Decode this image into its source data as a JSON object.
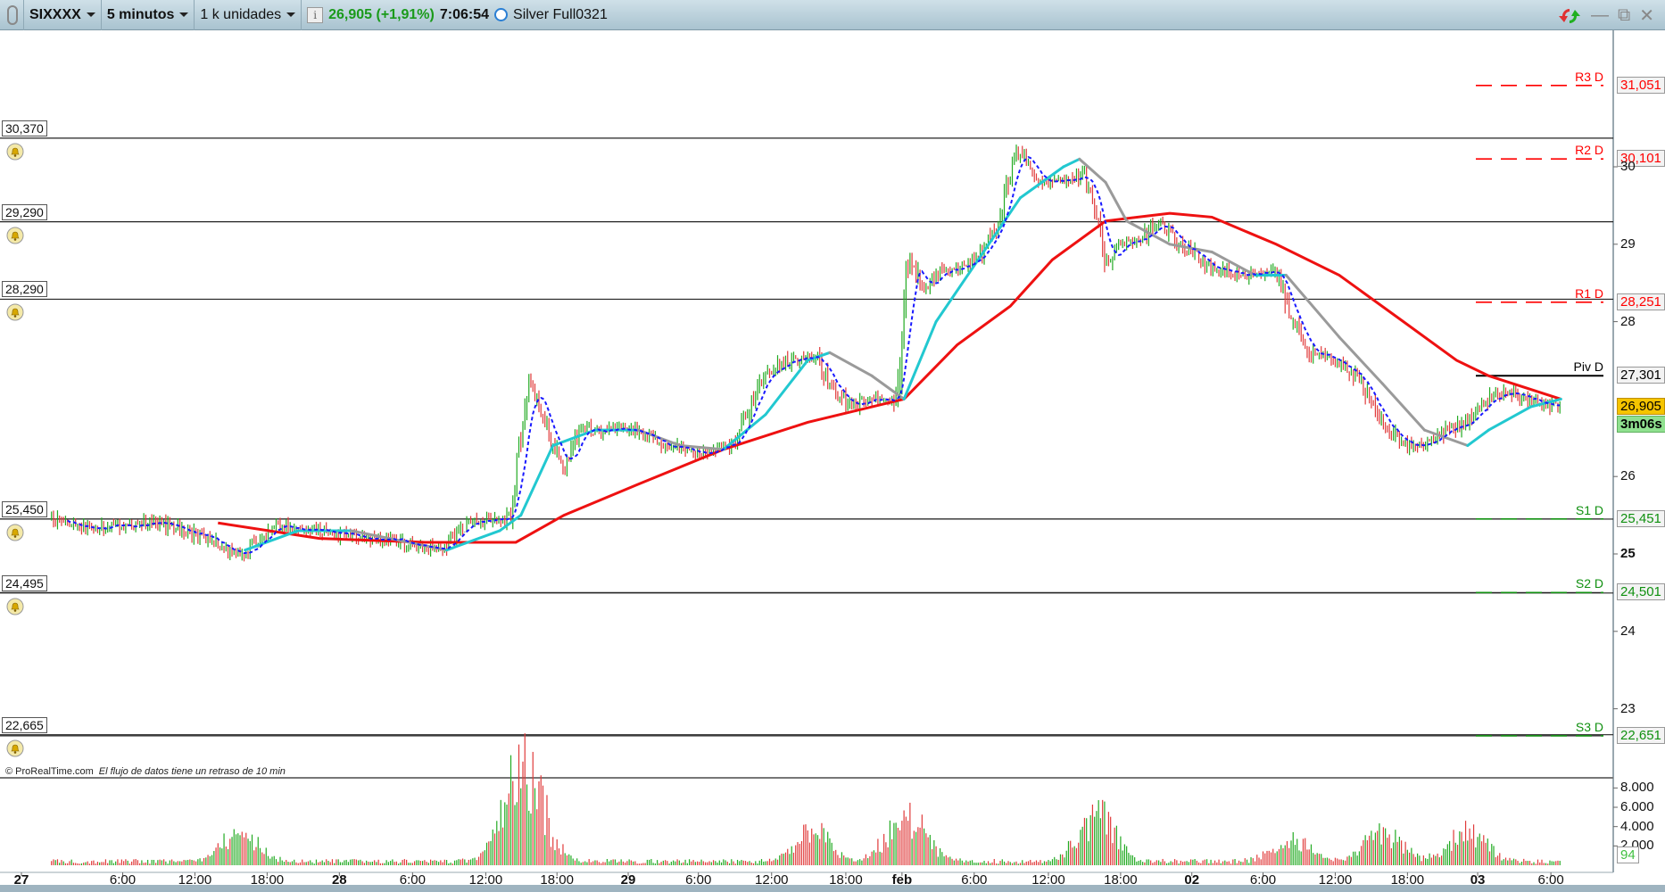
{
  "toolbar": {
    "symbol": "SIXXXX",
    "timeframe": "5 minutos",
    "units": "1 k unidades",
    "price": "26,905 (+1,91%)",
    "time": "7:06:54",
    "instrument": "Silver Full0321"
  },
  "footer": {
    "copyright": "© ProRealTime.com",
    "delay_notice": "El flujo de datos tiene un retraso de 10 min"
  },
  "colors": {
    "up": "#22aa22",
    "down": "#e03a3a",
    "long_ma": "#ee1111",
    "trend_up": "#22c8d0",
    "trend_down": "#9a9a9a",
    "fast_ma": "#1a1aff",
    "resistance": "#ff0000",
    "support": "#109010"
  },
  "chart_data": {
    "type": "line",
    "title": "SIXXXX 5 minutos",
    "ylim": [
      22.2,
      31.7
    ],
    "y_ticks": [
      "30",
      "29",
      "28",
      "26",
      "25",
      "24",
      "23"
    ],
    "y_tick_values": [
      30,
      29,
      28,
      26,
      25,
      24,
      23
    ],
    "x_unit": "5-minute bar index",
    "x_ticks": [
      {
        "bar": 0,
        "label": "27"
      },
      {
        "bar": 101,
        "label": "6:00"
      },
      {
        "bar": 173,
        "label": "12:00"
      },
      {
        "bar": 245,
        "label": "18:00"
      },
      {
        "bar": 317,
        "label": "28"
      },
      {
        "bar": 390,
        "label": "6:00"
      },
      {
        "bar": 463,
        "label": "12:00"
      },
      {
        "bar": 534,
        "label": "18:00"
      },
      {
        "bar": 605,
        "label": "29"
      },
      {
        "bar": 675,
        "label": "6:00"
      },
      {
        "bar": 748,
        "label": "12:00"
      },
      {
        "bar": 822,
        "label": "18:00"
      },
      {
        "bar": 878,
        "label": "feb"
      },
      {
        "bar": 950,
        "label": "6:00"
      },
      {
        "bar": 1024,
        "label": "12:00"
      },
      {
        "bar": 1096,
        "label": "18:00"
      },
      {
        "bar": 1167,
        "label": "02"
      },
      {
        "bar": 1238,
        "label": "6:00"
      },
      {
        "bar": 1310,
        "label": "12:00"
      },
      {
        "bar": 1382,
        "label": "18:00"
      },
      {
        "bar": 1452,
        "label": "03"
      },
      {
        "bar": 1525,
        "label": "6:00"
      }
    ],
    "price": [
      [
        30,
        25.45
      ],
      [
        64,
        25.35
      ],
      [
        138,
        25.4
      ],
      [
        186,
        25.2
      ],
      [
        217,
        24.95
      ],
      [
        254,
        25.35
      ],
      [
        297,
        25.3
      ],
      [
        339,
        25.2
      ],
      [
        382,
        25.15
      ],
      [
        419,
        25.05
      ],
      [
        445,
        25.4
      ],
      [
        488,
        25.45
      ],
      [
        498,
        26.5
      ],
      [
        506,
        27.2
      ],
      [
        519,
        26.8
      ],
      [
        541,
        26.1
      ],
      [
        557,
        26.6
      ],
      [
        583,
        26.6
      ],
      [
        615,
        26.6
      ],
      [
        636,
        26.4
      ],
      [
        678,
        26.3
      ],
      [
        710,
        26.4
      ],
      [
        726,
        26.9
      ],
      [
        742,
        27.3
      ],
      [
        763,
        27.5
      ],
      [
        790,
        27.6
      ],
      [
        806,
        27.2
      ],
      [
        827,
        26.9
      ],
      [
        848,
        27.0
      ],
      [
        875,
        27.0
      ],
      [
        882,
        28.9
      ],
      [
        901,
        28.4
      ],
      [
        912,
        28.6
      ],
      [
        933,
        28.7
      ],
      [
        954,
        28.8
      ],
      [
        975,
        29.3
      ],
      [
        991,
        30.2
      ],
      [
        1002,
        30.1
      ],
      [
        1018,
        29.8
      ],
      [
        1039,
        29.8
      ],
      [
        1060,
        29.9
      ],
      [
        1071,
        29.4
      ],
      [
        1081,
        28.7
      ],
      [
        1092,
        29.0
      ],
      [
        1113,
        29.0
      ],
      [
        1134,
        29.3
      ],
      [
        1155,
        29.0
      ],
      [
        1187,
        28.7
      ],
      [
        1219,
        28.6
      ],
      [
        1251,
        28.7
      ],
      [
        1267,
        28.0
      ],
      [
        1283,
        27.6
      ],
      [
        1314,
        27.5
      ],
      [
        1336,
        27.2
      ],
      [
        1357,
        26.7
      ],
      [
        1378,
        26.4
      ],
      [
        1399,
        26.4
      ],
      [
        1420,
        26.6
      ],
      [
        1442,
        26.7
      ],
      [
        1463,
        27.0
      ],
      [
        1484,
        27.1
      ],
      [
        1505,
        27.0
      ],
      [
        1535,
        26.9
      ]
    ],
    "long_ma": [
      [
        196,
        25.4
      ],
      [
        297,
        25.2
      ],
      [
        403,
        25.15
      ],
      [
        493,
        25.15
      ],
      [
        541,
        25.5
      ],
      [
        615,
        25.9
      ],
      [
        700,
        26.35
      ],
      [
        784,
        26.7
      ],
      [
        880,
        27.0
      ],
      [
        933,
        27.7
      ],
      [
        986,
        28.2
      ],
      [
        1028,
        28.8
      ],
      [
        1081,
        29.3
      ],
      [
        1145,
        29.4
      ],
      [
        1187,
        29.35
      ],
      [
        1251,
        29.0
      ],
      [
        1314,
        28.6
      ],
      [
        1378,
        28.0
      ],
      [
        1431,
        27.5
      ],
      [
        1463,
        27.3
      ],
      [
        1535,
        27.0
      ]
    ],
    "trend_line": [
      [
        223,
        25.05
      ],
      [
        276,
        25.3
      ],
      [
        329,
        25.3
      ],
      [
        424,
        25.05
      ],
      [
        477,
        25.3
      ],
      [
        498,
        25.5
      ],
      [
        530,
        26.4
      ],
      [
        572,
        26.6
      ],
      [
        615,
        26.6
      ],
      [
        657,
        26.4
      ],
      [
        700,
        26.35
      ],
      [
        742,
        26.8
      ],
      [
        784,
        27.5
      ],
      [
        806,
        27.6
      ],
      [
        848,
        27.3
      ],
      [
        880,
        27.0
      ],
      [
        912,
        28.0
      ],
      [
        954,
        28.8
      ],
      [
        996,
        29.6
      ],
      [
        1039,
        30.0
      ],
      [
        1055,
        30.1
      ],
      [
        1081,
        29.8
      ],
      [
        1102,
        29.3
      ],
      [
        1145,
        29.0
      ],
      [
        1187,
        28.9
      ],
      [
        1230,
        28.6
      ],
      [
        1261,
        28.6
      ],
      [
        1314,
        27.8
      ],
      [
        1357,
        27.2
      ],
      [
        1399,
        26.6
      ],
      [
        1442,
        26.4
      ],
      [
        1463,
        26.6
      ],
      [
        1505,
        26.9
      ],
      [
        1535,
        27.0
      ]
    ],
    "alert_levels": [
      "30,370",
      "29,290",
      "28,290",
      "25,450",
      "24,495",
      "22,665"
    ],
    "alert_values": [
      30.37,
      29.29,
      28.29,
      25.45,
      24.495,
      22.665
    ],
    "pivots": [
      {
        "name": "R3 D",
        "label": "31,051",
        "value": 31.051,
        "kind": "resistance"
      },
      {
        "name": "R2 D",
        "label": "30,101",
        "value": 30.101,
        "kind": "resistance"
      },
      {
        "name": "R1 D",
        "label": "28,251",
        "value": 28.251,
        "kind": "resistance"
      },
      {
        "name": "Piv D",
        "label": "27,301",
        "value": 27.301,
        "kind": "pivot"
      },
      {
        "name": "S1 D",
        "label": "25,451",
        "value": 25.451,
        "kind": "support"
      },
      {
        "name": "S2 D",
        "label": "24,501",
        "value": 24.501,
        "kind": "support"
      },
      {
        "name": "S3 D",
        "label": "22,651",
        "value": 22.651,
        "kind": "support"
      }
    ],
    "last_price": {
      "label": "26,905",
      "value": 26.905
    },
    "countdown": "3m06s",
    "volume": {
      "y_ticks": [
        "8.000",
        "6.000",
        "4.000",
        "2.000"
      ],
      "y_tick_values": [
        8000,
        6000,
        4000,
        2000
      ],
      "last": "94",
      "peaks": [
        [
          217,
          4500
        ],
        [
          495,
          8000
        ],
        [
          508,
          7000
        ],
        [
          790,
          4500
        ],
        [
          882,
          8000
        ],
        [
          1072,
          7000
        ],
        [
          1267,
          3500
        ],
        [
          1357,
          4500
        ],
        [
          1442,
          4500
        ]
      ]
    }
  }
}
